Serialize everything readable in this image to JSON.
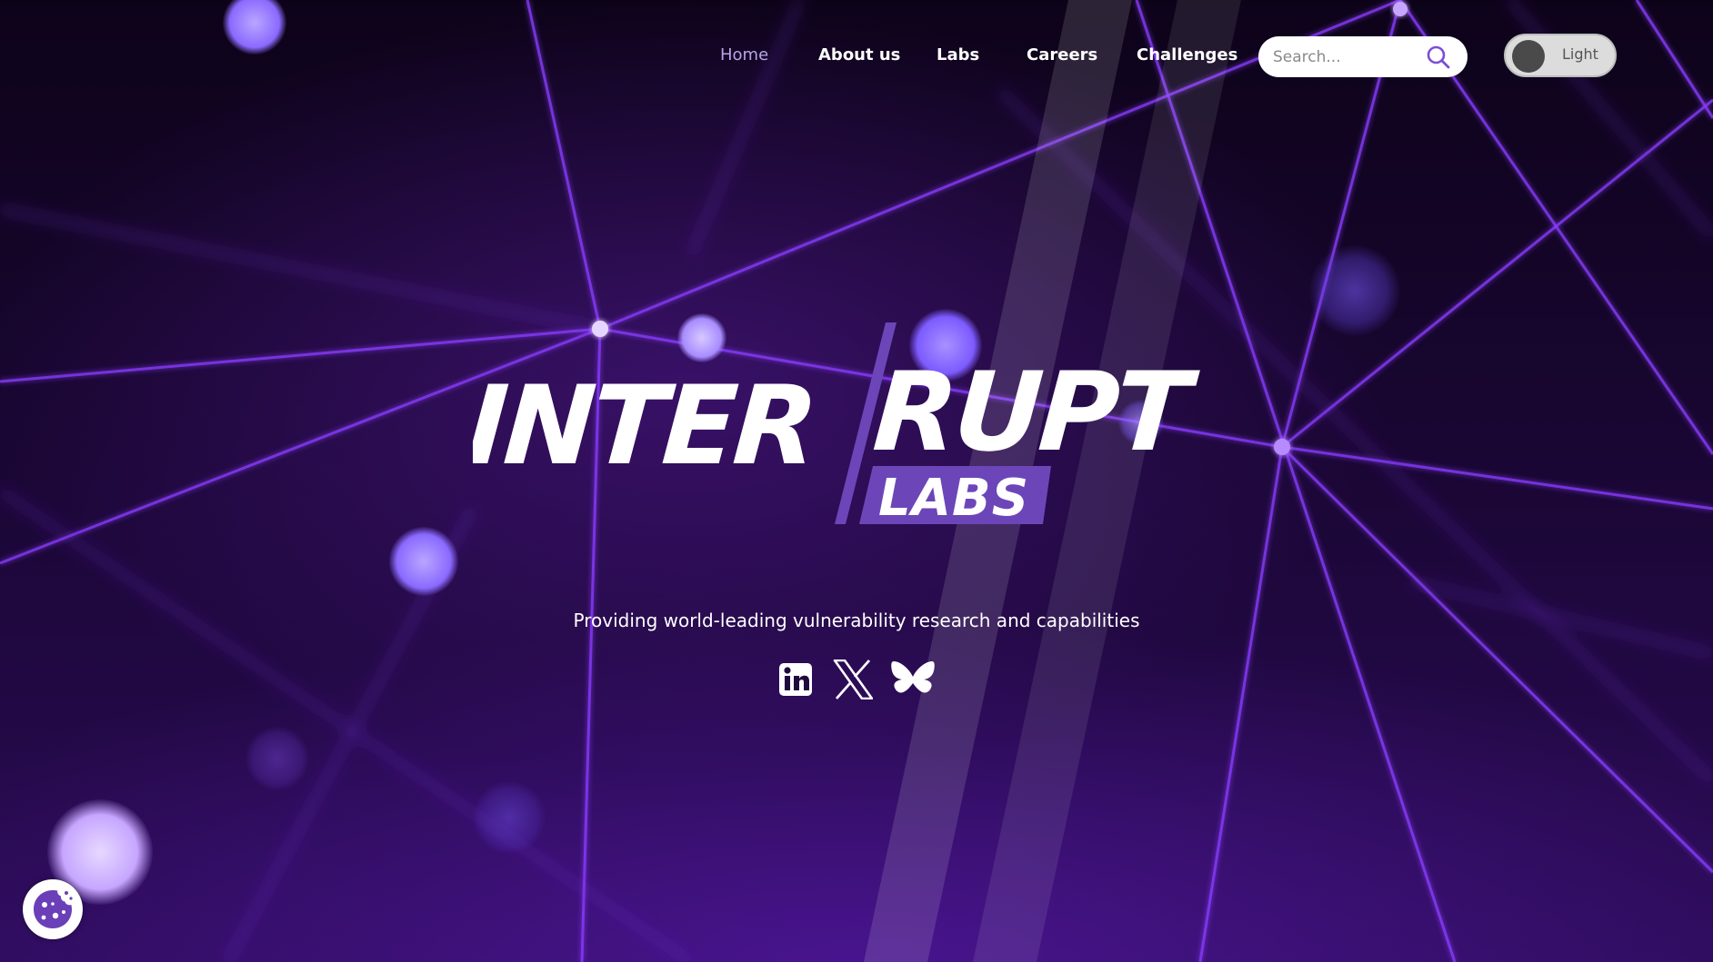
{
  "nav": {
    "items": [
      {
        "label": "Home",
        "active": true
      },
      {
        "label": "About us",
        "active": false
      },
      {
        "label": "Labs",
        "active": false
      },
      {
        "label": "Careers",
        "active": false
      },
      {
        "label": "Challenges",
        "active": false
      }
    ]
  },
  "search": {
    "placeholder": "Search...",
    "icon": "search-icon"
  },
  "theme_toggle": {
    "label": "Light"
  },
  "hero": {
    "logo": {
      "word_left": "INTER",
      "word_right": "RUPT",
      "sub": "LABS"
    },
    "tagline": "Providing world-leading vulnerability research and capabilities"
  },
  "social": [
    {
      "icon": "linkedin-icon"
    },
    {
      "icon": "x-icon"
    },
    {
      "icon": "bluesky-icon"
    }
  ],
  "cookie_button": {
    "icon": "cookie-icon"
  },
  "colors": {
    "accent": "#7b4fd6",
    "nav_active": "#b7a6e8",
    "background": "#1a0634",
    "labs_box": "#6c46b8"
  }
}
